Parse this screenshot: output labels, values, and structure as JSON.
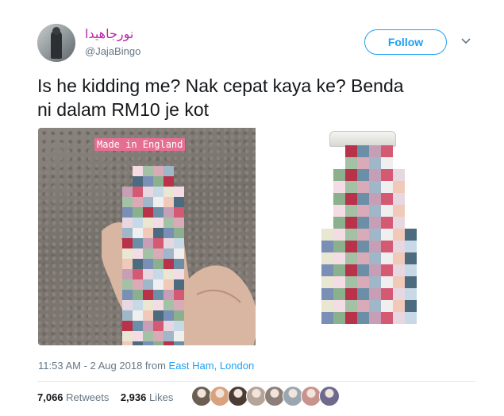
{
  "user": {
    "display_name": "نورجاهيدا",
    "handle": "@JajaBingo",
    "avatar_icon": "profile-photo"
  },
  "follow": {
    "label": "Follow",
    "accent": "#1da1f2"
  },
  "menu": {
    "icon": "chevron-down-icon"
  },
  "tweet": {
    "text": "Is he kidding me? Nak cepat kaya ke? Benda\nni dalam RM10 je kot"
  },
  "media": {
    "left_label": "Made in England"
  },
  "meta": {
    "time": "11:53 AM - 2 Aug 2018 from ",
    "location": "East Ham, London"
  },
  "stats": {
    "retweets_count": "7,066",
    "retweets_label": " Retweets",
    "likes_count": "2,936",
    "likes_label": " Likes"
  },
  "likers": [
    "#6b5e53",
    "#d9a27c",
    "#4a3b34",
    "#b6a39a",
    "#8c7f78",
    "#9aa7b0",
    "#c9938d",
    "#6d6a8e"
  ]
}
